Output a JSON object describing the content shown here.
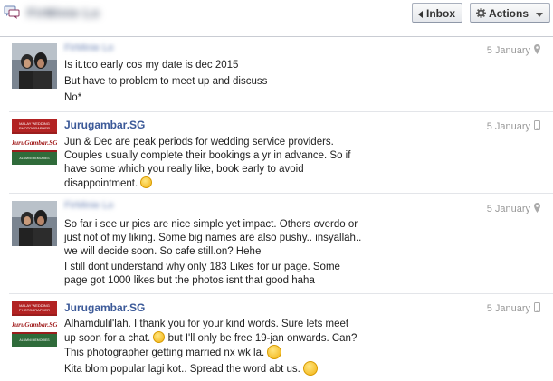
{
  "header": {
    "name": "FirMinie Lo",
    "inbox_label": "Inbox",
    "actions_label": "Actions"
  },
  "messages": [
    {
      "sender": "FirMinie Lo",
      "date": "5 January",
      "lines": [
        "Is it.too early cos my date is dec 2015",
        "But have to problem to meet up and discuss",
        "No*"
      ]
    },
    {
      "sender": "Jurugambar.SG",
      "date": "5 January",
      "lines": [
        "Jun & Dec are peak periods for wedding service providers.",
        "Couples usually complete their bookings a yr in advance. So if",
        "have some which you really like, book early to avoid",
        "disappointment."
      ]
    },
    {
      "sender": "FirMinie Lo",
      "date": "5 January",
      "lines": [
        "So far i see ur pics are nice simple yet impact. Others overdo or",
        "just not of my liking. Some big names are also pushy.. insyallah..",
        "we will decide soon. So cafe still.on? Hehe",
        "I still dont understand why only 183 Likes for ur page. Some",
        "page got 1000 likes but the photos isnt that good haha"
      ]
    },
    {
      "sender": "Jurugambar.SG",
      "date": "5 January",
      "lines": [
        "Alhamdulil'lah. I thank you for your kind words. Sure lets meet",
        "up soon for a chat.",
        "but I'll only be free 19-jan onwards. Can?",
        "This photographer getting married nx wk la.",
        "Kita blom popular lagi kot.. Spread the word abt us."
      ]
    }
  ],
  "logo": {
    "line1": "MALAY WEDDING",
    "line2": "PHOTOGRAPHER",
    "brand": "JuruGambar.SG",
    "line3": "ALUMNI MEMORIES"
  }
}
